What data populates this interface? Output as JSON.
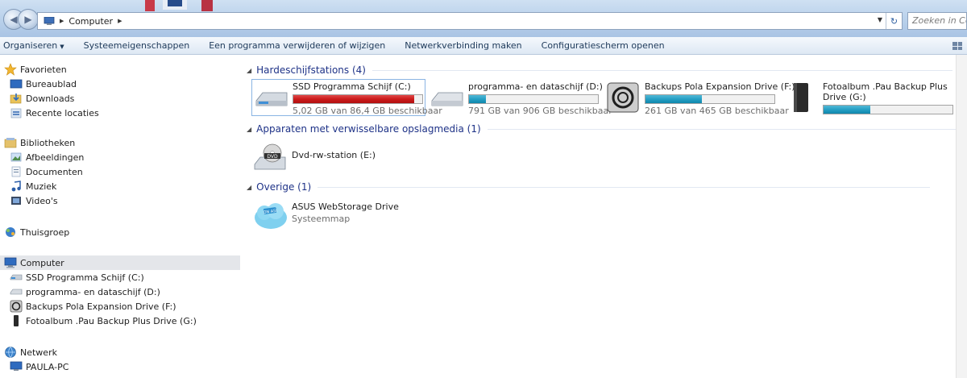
{
  "address_bar": {
    "crumbs": [
      "Computer"
    ],
    "search_placeholder": "Zoeken in Comp"
  },
  "toolbar": {
    "organize_label": "Organiseren",
    "items": [
      "Systeemeigenschappen",
      "Een programma verwijderen of wijzigen",
      "Netwerkverbinding maken",
      "Configuratiescherm openen"
    ]
  },
  "nav": {
    "favorites": {
      "label": "Favorieten",
      "items": [
        "Bureaublad",
        "Downloads",
        "Recente locaties"
      ]
    },
    "libraries": {
      "label": "Bibliotheken",
      "items": [
        "Afbeeldingen",
        "Documenten",
        "Muziek",
        "Video's"
      ]
    },
    "homegroup": {
      "label": "Thuisgroep"
    },
    "computer": {
      "label": "Computer",
      "items": [
        "SSD Programma Schijf (C:)",
        "programma- en dataschijf (D:)",
        "Backups Pola Expansion Drive (F:)",
        "Fotoalbum .Pau Backup Plus Drive (G:)"
      ]
    },
    "network": {
      "label": "Netwerk",
      "items": [
        "PAULA-PC"
      ]
    }
  },
  "content": {
    "hard_drives": {
      "title": "Hardeschijfstations (4)",
      "drives": [
        {
          "name": "SSD Programma Schijf (C:)",
          "free": "5,02 GB van 86,4 GB beschikbaar",
          "used_fraction": 0.94,
          "bar_color": "#cc1b1b",
          "icon": "hard-drive-icon"
        },
        {
          "name": "programma- en dataschijf (D:)",
          "free": "791 GB van 906 GB beschikbaar",
          "used_fraction": 0.13,
          "bar_color": "#26a0c4",
          "icon": "hard-drive-icon"
        },
        {
          "name": "Backups Pola Expansion Drive (F:)",
          "free": "261 GB van 465 GB beschikbaar",
          "used_fraction": 0.44,
          "bar_color": "#26a0c4",
          "icon": "seagate-drive-icon"
        },
        {
          "name": "Fotoalbum .Pau Backup Plus Drive (G:)",
          "free": "",
          "used_fraction": 0.36,
          "bar_color": "#26a0c4",
          "icon": "external-drive-icon"
        }
      ]
    },
    "removable": {
      "title": "Apparaten met verwisselbare opslagmedia (1)",
      "items": [
        {
          "name": "Dvd-rw-station (E:)",
          "icon": "dvd-drive-icon"
        }
      ]
    },
    "other": {
      "title": "Overige (1)",
      "items": [
        {
          "name": "ASUS WebStorage Drive",
          "sub": "Systeemmap",
          "icon": "asus-webstorage-icon"
        }
      ]
    }
  }
}
